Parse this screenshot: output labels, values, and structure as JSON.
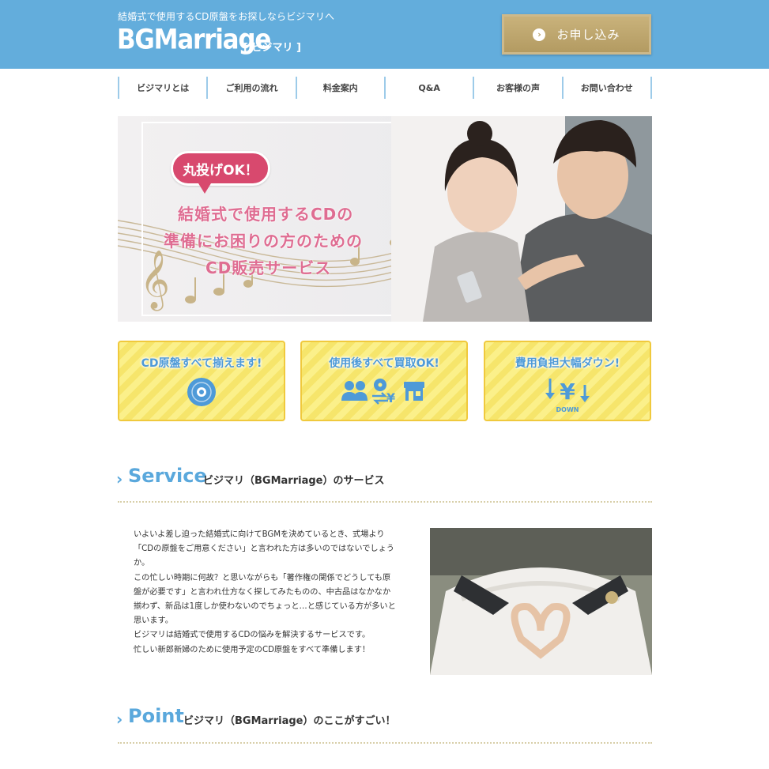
{
  "header": {
    "tagline": "結婚式で使用するCD原盤をお探しならビジマリへ",
    "logo": "BGMarriage",
    "logo_sub": "[ ビジマリ ]",
    "apply_label": "お申し込み",
    "apply_icon": "chevron-right-circle-icon",
    "colors": {
      "header_bg": "#63addc",
      "button_gold": "#b39b62"
    }
  },
  "nav": {
    "items": [
      {
        "label": "ビジマリとは"
      },
      {
        "label": "ご利用の流れ"
      },
      {
        "label": "料金案内"
      },
      {
        "label": "Q&A"
      },
      {
        "label": "お客様の声"
      },
      {
        "label": "お問い合わせ"
      }
    ]
  },
  "hero": {
    "bubble": "丸投げOK！",
    "lines": [
      "結婚式で使用するCDの",
      "準備にお困りの方のための",
      "CD販売サービス"
    ],
    "accent": "#df6d92"
  },
  "features": [
    {
      "title": "CD原盤すべて揃えます!",
      "icon": "cd-disc-icon"
    },
    {
      "title": "使用後すべて買取OK!",
      "icon": "people-cd-exchange-shop-icon"
    },
    {
      "title": "費用負担大幅ダウン!",
      "icon": "yen-down-icon",
      "icon_text": "DOWN"
    }
  ],
  "service": {
    "en": "Service",
    "jp": "ビジマリ（BGMarriage）のサービス",
    "lines": [
      "いよいよ差し迫った結婚式に向けてBGMを決めているとき、式場より",
      "「CDの原盤をご用意ください」と言われた方は多いのではないでしょう",
      "か。",
      "この忙しい時期に何故？と思いながらも「著作権の関係でどうしても原",
      "盤が必要です」と言われ仕方なく探してみたものの、中古品はなかなか",
      "揃わず、新品は1度しか使わないのでちょっと…と感じている方が多いと",
      "思います。",
      "ビジマリは結婚式で使用するCDの悩みを解決するサービスです。",
      "忙しい新郎新婦のために使用予定のCD原盤をすべて準備します！"
    ]
  },
  "point": {
    "en": "Point",
    "jp": "ビジマリ（BGMarriage）のここがすごい！"
  }
}
